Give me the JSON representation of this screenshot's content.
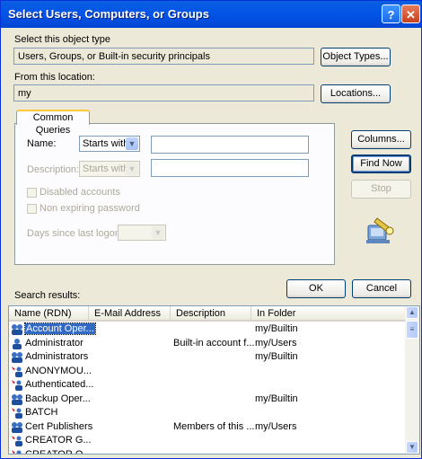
{
  "window": {
    "title": "Select Users, Computers, or Groups",
    "help": "?",
    "close": "✕"
  },
  "object_type": {
    "label": "Select this object type",
    "value": "Users, Groups, or Built-in security principals",
    "button": "Object Types..."
  },
  "location": {
    "label": "From this location:",
    "value": "my",
    "button": "Locations..."
  },
  "tab": {
    "label": "Common Queries"
  },
  "query": {
    "name_label": "Name:",
    "name_op": "Starts with",
    "desc_label": "Description:",
    "desc_op": "Starts with",
    "disabled_accounts": "Disabled accounts",
    "non_expiring": "Non expiring password",
    "days_label": "Days since last logon:"
  },
  "side_buttons": {
    "columns": "Columns...",
    "find_now": "Find Now",
    "stop": "Stop"
  },
  "ok": "OK",
  "cancel": "Cancel",
  "results": {
    "label": "Search results:",
    "columns": [
      "Name (RDN)",
      "E-Mail Address",
      "Description",
      "In Folder"
    ],
    "rows": [
      {
        "name": "Account Oper...",
        "description": "",
        "folder": "my/Builtin",
        "icon": "group-icon"
      },
      {
        "name": "Administrator",
        "description": "Built-in account f...",
        "folder": "my/Users",
        "icon": "user-icon"
      },
      {
        "name": "Administrators",
        "description": "",
        "folder": "my/Builtin",
        "icon": "group-icon"
      },
      {
        "name": "ANONYMOU...",
        "description": "",
        "folder": "",
        "icon": "principal-icon"
      },
      {
        "name": "Authenticated...",
        "description": "",
        "folder": "",
        "icon": "principal-icon"
      },
      {
        "name": "Backup Oper...",
        "description": "",
        "folder": "my/Builtin",
        "icon": "group-icon"
      },
      {
        "name": "BATCH",
        "description": "",
        "folder": "",
        "icon": "principal-icon"
      },
      {
        "name": "Cert Publishers",
        "description": "Members of this ...",
        "folder": "my/Users",
        "icon": "group-icon"
      },
      {
        "name": "CREATOR G...",
        "description": "",
        "folder": "",
        "icon": "principal-icon"
      },
      {
        "name": "CREATOR O...",
        "description": "",
        "folder": "",
        "icon": "principal-icon"
      }
    ]
  }
}
